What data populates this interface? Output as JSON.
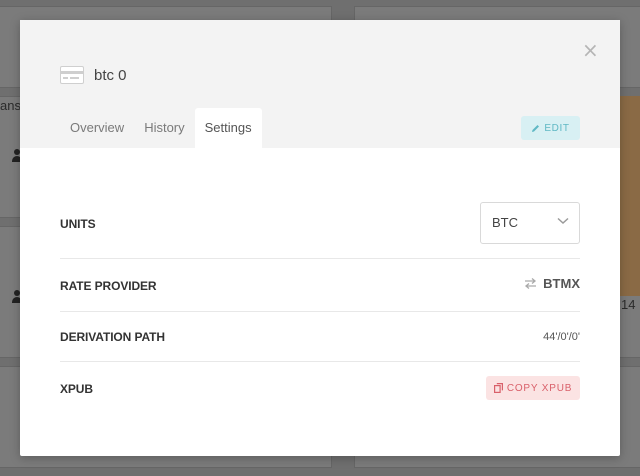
{
  "background": {
    "partial_label_left": "ansa",
    "partial_number_right": "14"
  },
  "modal": {
    "title": "btc 0",
    "close_glyph": "×",
    "tabs": [
      {
        "label": "Overview",
        "active": false
      },
      {
        "label": "History",
        "active": false
      },
      {
        "label": "Settings",
        "active": true
      }
    ],
    "edit_label": "EDIT",
    "settings": {
      "units": {
        "label": "UNITS",
        "value": "BTC"
      },
      "rate_provider": {
        "label": "RATE PROVIDER",
        "value": "BTMX",
        "icon": "swap-arrows-icon"
      },
      "derivation_path": {
        "label": "DERIVATION PATH",
        "value": "44'/0'/0'"
      },
      "xpub": {
        "label": "XPUB",
        "button_label": "COPY XPUB",
        "icon": "copy-icon"
      }
    }
  },
  "colors": {
    "accent_teal": "#5fb8c4",
    "accent_teal_bg": "#d8f0f3",
    "accent_red": "#d9606a",
    "accent_red_bg": "#fbe3e3",
    "header_bg": "#f3f3f3"
  }
}
